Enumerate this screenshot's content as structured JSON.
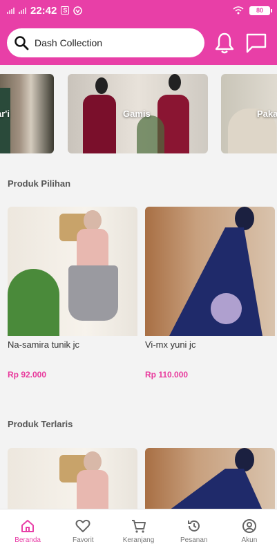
{
  "status_bar": {
    "time": "22:42",
    "battery": "80"
  },
  "search": {
    "value": "Dash Collection"
  },
  "categories": [
    {
      "label": "ar'i"
    },
    {
      "label": "Gamis"
    },
    {
      "label": "Paka"
    }
  ],
  "sections": {
    "pilihan_title": "Produk Pilihan",
    "terlaris_title": "Produk Terlaris"
  },
  "products_pilihan": [
    {
      "name": "Na-samira tunik jc",
      "price": "Rp 92.000"
    },
    {
      "name": "Vi-mx yuni jc",
      "price": "Rp 110.000"
    }
  ],
  "bottom_nav": [
    {
      "label": "Beranda",
      "icon": "home-icon"
    },
    {
      "label": "Favorit",
      "icon": "heart-icon"
    },
    {
      "label": "Keranjang",
      "icon": "cart-icon"
    },
    {
      "label": "Pesanan",
      "icon": "history-icon"
    },
    {
      "label": "Akun",
      "icon": "account-icon"
    }
  ],
  "colors": {
    "primary": "#e83fa7",
    "price": "#e8399c"
  }
}
